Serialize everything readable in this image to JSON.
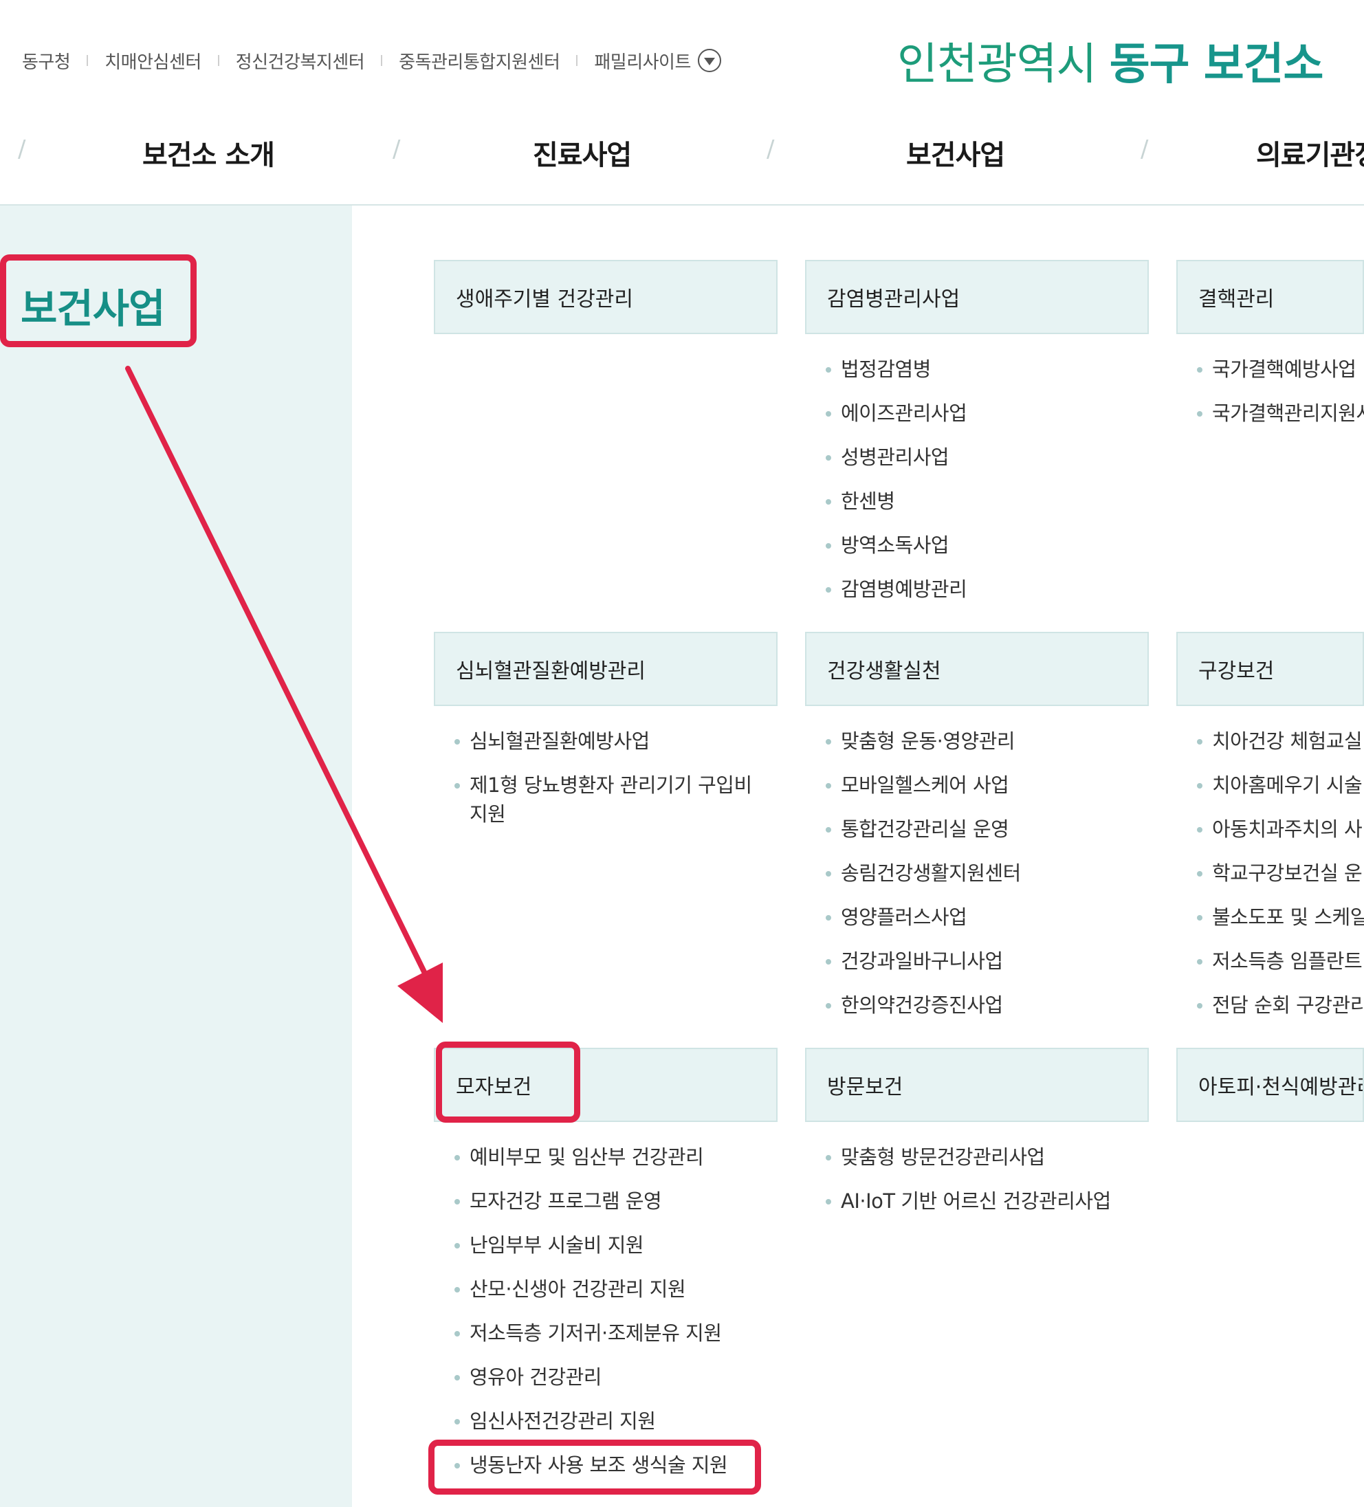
{
  "util": {
    "links": [
      "동구청",
      "치매안심센터",
      "정신건강복지센터",
      "중독관리통합지원센터"
    ],
    "family_site": "패밀리사이트"
  },
  "brand": {
    "part1": "인천광역시",
    "part2": "동구 보건소"
  },
  "gnb": [
    "보건소 소개",
    "진료사업",
    "보건사업",
    "의료기관정"
  ],
  "sidebar": {
    "title": "보건사업"
  },
  "menu": {
    "card1": {
      "title": "생애주기별 건강관리",
      "items": []
    },
    "card2": {
      "title": "감염병관리사업",
      "items": [
        "법정감염병",
        "에이즈관리사업",
        "성병관리사업",
        "한센병",
        "방역소독사업",
        "감염병예방관리"
      ]
    },
    "card3": {
      "title": "결핵관리",
      "items": [
        "국가결핵예방사업",
        "국가결핵관리지원사"
      ]
    },
    "card4": {
      "title": "심뇌혈관질환예방관리",
      "items": [
        "심뇌혈관질환예방사업",
        "제1형 당뇨병환자 관리기기 구입비 지원"
      ]
    },
    "card5": {
      "title": "건강생활실천",
      "items": [
        "맞춤형 운동·영양관리",
        "모바일헬스케어 사업",
        "통합건강관리실 운영",
        "송림건강생활지원센터",
        "영양플러스사업",
        "건강과일바구니사업",
        "한의약건강증진사업"
      ]
    },
    "card6": {
      "title": "구강보건",
      "items": [
        "치아건강 체험교실",
        "치아홈메우기 시술",
        "아동치과주치의 사",
        "학교구강보건실 운",
        "불소도포 및 스케일",
        "저소득층 임플란트",
        "전담 순회 구강관리"
      ]
    },
    "card7": {
      "title": "모자보건",
      "items": [
        "예비부모 및 임산부 건강관리",
        "모자건강 프로그램 운영",
        "난임부부 시술비 지원",
        "산모·신생아 건강관리 지원",
        "저소득층 기저귀·조제분유 지원",
        "영유아 건강관리",
        "임신사전건강관리 지원",
        "냉동난자 사용 보조 생식술 지원"
      ]
    },
    "card8": {
      "title": "방문보건",
      "items": [
        "맞춤형 방문건강관리사업",
        "AI·IoT 기반 어르신 건강관리사업"
      ]
    },
    "card9": {
      "title": "아토피·천식예방관리",
      "items": []
    }
  },
  "annotation_color": "#e02348"
}
